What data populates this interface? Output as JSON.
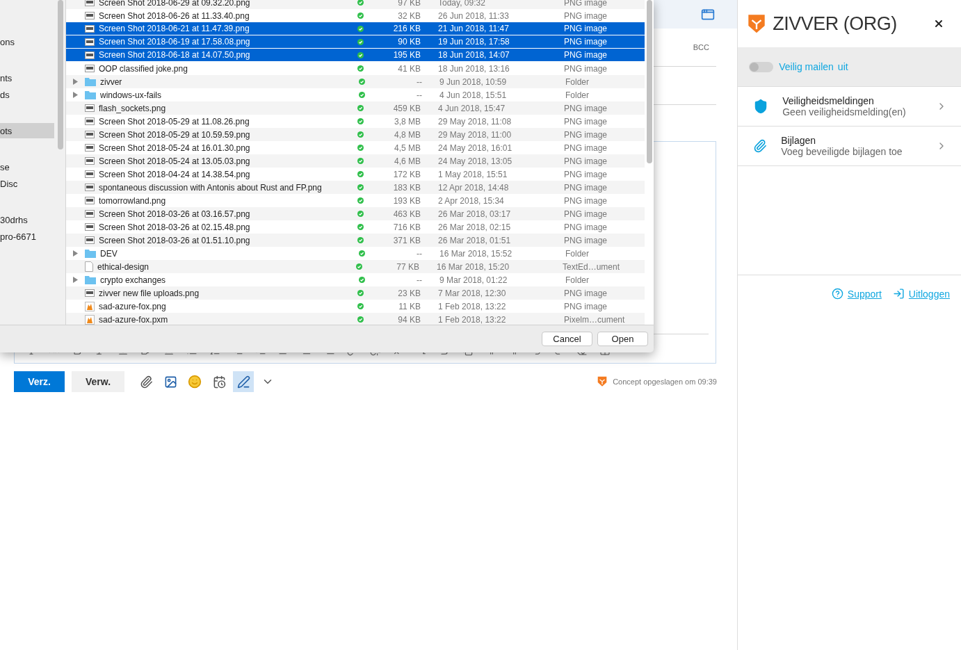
{
  "file_dialog": {
    "sidebar": {
      "sections": [
        {
          "items": [
            {
              "label": "ons",
              "selected": false
            }
          ]
        },
        {
          "items": [
            {
              "label": "nts",
              "selected": false
            },
            {
              "label": "ds",
              "selected": false
            }
          ]
        },
        {
          "items": [
            {
              "label": "ots",
              "selected": true
            }
          ]
        },
        {
          "items": [
            {
              "label": "se",
              "selected": false
            },
            {
              "label": "Disc",
              "selected": false
            }
          ]
        },
        {
          "items": [
            {
              "label": "30drhs",
              "selected": false
            },
            {
              "label": "pro-6671",
              "selected": false
            }
          ]
        }
      ]
    },
    "files": [
      {
        "kind": "image",
        "name": "Screen Shot 2018-06-29 at 09.32.20.png",
        "size": "97 KB",
        "date": "Today, 09:32",
        "type": "PNG image",
        "selected": false
      },
      {
        "kind": "image",
        "name": "Screen Shot 2018-06-26 at 11.33.40.png",
        "size": "32 KB",
        "date": "26 Jun 2018, 11:33",
        "type": "PNG image",
        "selected": false
      },
      {
        "kind": "image",
        "name": "Screen Shot 2018-06-21 at 11.47.39.png",
        "size": "216 KB",
        "date": "21 Jun 2018, 11:47",
        "type": "PNG image",
        "selected": true
      },
      {
        "kind": "image",
        "name": "Screen Shot 2018-06-19 at 17.58.08.png",
        "size": "90 KB",
        "date": "19 Jun 2018, 17:58",
        "type": "PNG image",
        "selected": true
      },
      {
        "kind": "image",
        "name": "Screen Shot 2018-06-18 at 14.07.50.png",
        "size": "195 KB",
        "date": "18 Jun 2018, 14:07",
        "type": "PNG image",
        "selected": true
      },
      {
        "kind": "image",
        "name": "OOP classified joke.png",
        "size": "41 KB",
        "date": "18 Jun 2018, 13:16",
        "type": "PNG image",
        "selected": false
      },
      {
        "kind": "folder",
        "name": "zivver",
        "size": "--",
        "date": "9 Jun 2018, 10:59",
        "type": "Folder",
        "selected": false
      },
      {
        "kind": "folder",
        "name": "windows-ux-fails",
        "size": "--",
        "date": "4 Jun 2018, 15:51",
        "type": "Folder",
        "selected": false
      },
      {
        "kind": "image",
        "name": "flash_sockets.png",
        "size": "459 KB",
        "date": "4 Jun 2018, 15:47",
        "type": "PNG image",
        "selected": false
      },
      {
        "kind": "image",
        "name": "Screen Shot 2018-05-29 at 11.08.26.png",
        "size": "3,8 MB",
        "date": "29 May 2018, 11:08",
        "type": "PNG image",
        "selected": false
      },
      {
        "kind": "image",
        "name": "Screen Shot 2018-05-29 at 10.59.59.png",
        "size": "4,8 MB",
        "date": "29 May 2018, 11:00",
        "type": "PNG image",
        "selected": false
      },
      {
        "kind": "image",
        "name": "Screen Shot 2018-05-24 at 16.01.30.png",
        "size": "4,5 MB",
        "date": "24 May 2018, 16:01",
        "type": "PNG image",
        "selected": false
      },
      {
        "kind": "image",
        "name": "Screen Shot 2018-05-24 at 13.05.03.png",
        "size": "4,6 MB",
        "date": "24 May 2018, 13:05",
        "type": "PNG image",
        "selected": false
      },
      {
        "kind": "image",
        "name": "Screen Shot 2018-04-24 at 14.38.54.png",
        "size": "172 KB",
        "date": "1 May 2018, 15:51",
        "type": "PNG image",
        "selected": false
      },
      {
        "kind": "image",
        "name": "spontaneous discussion with Antonis about Rust and FP.png",
        "size": "183 KB",
        "date": "12 Apr 2018, 14:48",
        "type": "PNG image",
        "selected": false
      },
      {
        "kind": "image",
        "name": "tomorrowland.png",
        "size": "193 KB",
        "date": "2 Apr 2018, 15:34",
        "type": "PNG image",
        "selected": false
      },
      {
        "kind": "image",
        "name": "Screen Shot 2018-03-26 at 03.16.57.png",
        "size": "463 KB",
        "date": "26 Mar 2018, 03:17",
        "type": "PNG image",
        "selected": false
      },
      {
        "kind": "image",
        "name": "Screen Shot 2018-03-26 at 02.15.48.png",
        "size": "716 KB",
        "date": "26 Mar 2018, 02:15",
        "type": "PNG image",
        "selected": false
      },
      {
        "kind": "image",
        "name": "Screen Shot 2018-03-26 at 01.51.10.png",
        "size": "371 KB",
        "date": "26 Mar 2018, 01:51",
        "type": "PNG image",
        "selected": false
      },
      {
        "kind": "folder",
        "name": "DEV",
        "size": "--",
        "date": "16 Mar 2018, 15:52",
        "type": "Folder",
        "selected": false
      },
      {
        "kind": "document",
        "name": "ethical-design",
        "size": "77 KB",
        "date": "16 Mar 2018, 15:20",
        "type": "TextEd…ument",
        "selected": false
      },
      {
        "kind": "folder",
        "name": "crypto exchanges",
        "size": "--",
        "date": "9 Mar 2018, 01:22",
        "type": "Folder",
        "selected": false
      },
      {
        "kind": "image",
        "name": "zivver new file uploads.png",
        "size": "23 KB",
        "date": "7 Mar 2018, 12:30",
        "type": "PNG image",
        "selected": false
      },
      {
        "kind": "fox",
        "name": "sad-azure-fox.png",
        "size": "11 KB",
        "date": "1 Feb 2018, 13:22",
        "type": "PNG image",
        "selected": false
      },
      {
        "kind": "fox",
        "name": "sad-azure-fox.pxm",
        "size": "94 KB",
        "date": "1 Feb 2018, 13:22",
        "type": "Pixelm…cument",
        "selected": false
      }
    ],
    "buttons": [
      {
        "label": "Cancel",
        "default": false
      },
      {
        "label": "Open",
        "default": false
      }
    ]
  },
  "compose": {
    "bcc_label": "BCC",
    "send_label": "Verz.",
    "discard_label": "Verw.",
    "status": "Concept opgeslagen om 09:39"
  },
  "zivver_panel": {
    "title": "ZIVVER (ORG)",
    "toggle": {
      "label": "Veilig mailen",
      "state_text": "uit",
      "on": false
    },
    "items": [
      {
        "kind": "shield",
        "title": "Veiligheidsmeldingen",
        "subtitle": "Geen veiligheidsmelding(en)"
      },
      {
        "kind": "attachment",
        "title": "Bijlagen",
        "subtitle": "Voeg beveiligde bijlagen toe"
      }
    ],
    "links": [
      {
        "kind": "help",
        "label": "Support"
      },
      {
        "kind": "logout",
        "label": "Uitloggen"
      }
    ]
  }
}
